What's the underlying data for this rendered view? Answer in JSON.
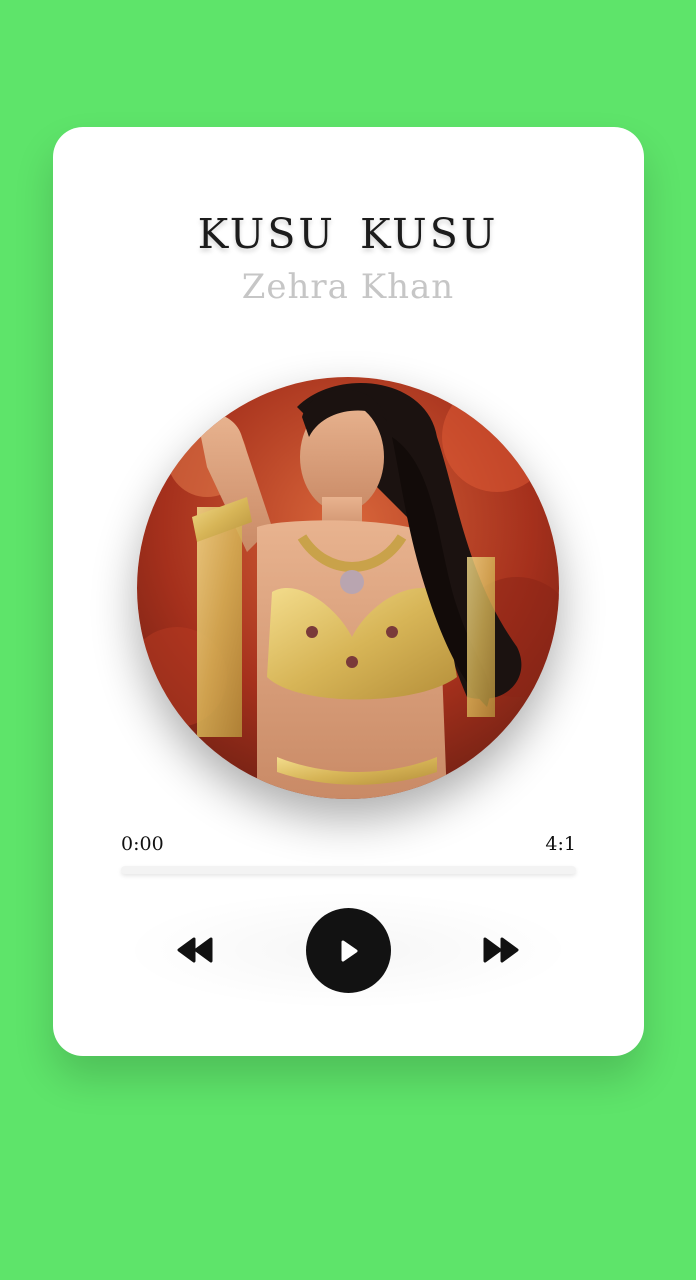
{
  "theme": {
    "background_color": "#5ee46a",
    "title_color": "#1c1c1c",
    "artist_color": "#c6c6c6"
  },
  "player": {
    "song_title": "KUSU  KUSU",
    "artist": "Zehra Khan",
    "cover_icon": "album-cover-image",
    "time_current": "0:00",
    "time_total": "4:1",
    "progress": 0
  },
  "controls": {
    "prev_icon": "rewind-icon",
    "play_icon": "play-icon",
    "next_icon": "fast-forward-icon"
  }
}
